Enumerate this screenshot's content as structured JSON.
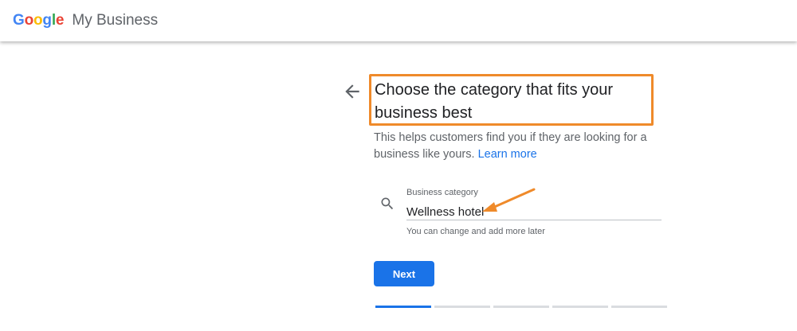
{
  "header": {
    "brand_letters": [
      {
        "char": "G",
        "color": "#4285F4"
      },
      {
        "char": "o",
        "color": "#EA4335"
      },
      {
        "char": "o",
        "color": "#FBBC05"
      },
      {
        "char": "g",
        "color": "#4285F4"
      },
      {
        "char": "l",
        "color": "#34A853"
      },
      {
        "char": "e",
        "color": "#EA4335"
      }
    ],
    "product_name": "My Business"
  },
  "page": {
    "back_icon": "arrow-back-icon",
    "title": "Choose the category that fits your business best",
    "subtitle": "This helps customers find you if they are looking for a business like yours.",
    "learn_more": "Learn more",
    "link_color": "#1a73e8",
    "highlight_color": "#ef8a2a"
  },
  "category_field": {
    "icon": "search-icon",
    "label": "Business category",
    "value": "Wellness hotel",
    "hint": "You can change and add more later"
  },
  "actions": {
    "next_label": "Next",
    "accent": "#1a73e8"
  },
  "progress": {
    "total_steps": 5,
    "current_step": 1
  }
}
